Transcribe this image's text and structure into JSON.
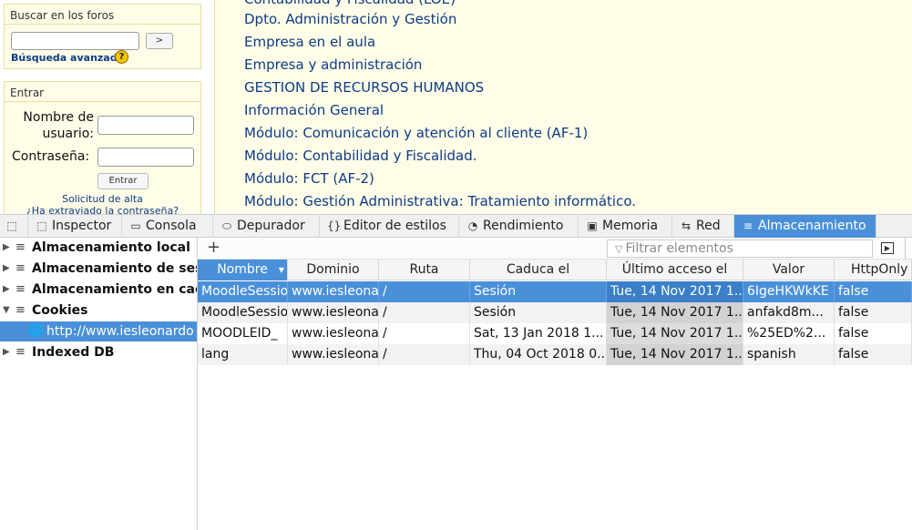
{
  "page": {
    "search_block": {
      "title": "Buscar en los foros",
      "search_button": ">",
      "advanced_link": "Búsqueda avanzada",
      "help_icon": "?"
    },
    "login_block": {
      "title": "Entrar",
      "username_label": "Nombre de usuario:",
      "password_label": "Contraseña:",
      "login_button": "Entrar",
      "signup_link": "Solicitud de alta",
      "forgot_link": "¿Ha extraviado la contraseña?"
    },
    "courses": [
      "Contabilidad y Fiscalidad (LOE)",
      "Dpto. Administración y Gestión",
      "Empresa en el aula",
      "Empresa y administración",
      "GESTION DE RECURSOS HUMANOS",
      "Información General",
      "Módulo: Comunicación y atención al cliente (AF-1)",
      "Módulo: Contabilidad y Fiscalidad.",
      "Módulo: FCT (AF-2)",
      "Módulo: Gestión Administrativa: Tratamiento informático."
    ]
  },
  "devtools": {
    "tools": [
      {
        "label": "Inspector",
        "icon": "inspector-icon",
        "glyph": "⬚"
      },
      {
        "label": "Consola",
        "icon": "console-icon",
        "glyph": "▭"
      },
      {
        "label": "Depurador",
        "icon": "debugger-icon",
        "glyph": "⬭"
      },
      {
        "label": "Editor de estilos",
        "icon": "style-editor-icon",
        "glyph": "{}"
      },
      {
        "label": "Rendimiento",
        "icon": "performance-icon",
        "glyph": "◔"
      },
      {
        "label": "Memoria",
        "icon": "memory-icon",
        "glyph": "▣"
      },
      {
        "label": "Red",
        "icon": "network-icon",
        "glyph": "⇆"
      },
      {
        "label": "Almacenamiento",
        "icon": "storage-icon",
        "glyph": "≡"
      }
    ],
    "active_tool": "Almacenamiento",
    "tree": [
      {
        "label": "Almacenamiento local",
        "expanded": false
      },
      {
        "label": "Almacenamiento de sesión",
        "expanded": false
      },
      {
        "label": "Almacenamiento en caché",
        "expanded": false
      },
      {
        "label": "Cookies",
        "expanded": true
      },
      {
        "label": "http://www.iesleonardo",
        "selected": true
      },
      {
        "label": "Indexed DB",
        "expanded": false
      }
    ],
    "filter_placeholder": "Filtrar elementos",
    "add_glyph": "+",
    "columns": [
      "Nombre",
      "Dominio",
      "Ruta",
      "Caduca el",
      "Último acceso el",
      "Valor",
      "HttpOnly"
    ],
    "sorted_column": "Nombre",
    "rows": [
      [
        "MoodleSession",
        "www.iesleonardo.info",
        "/",
        "Sesión",
        "Tue, 14 Nov 2017 1...",
        "6IgeHKWkKE",
        "false"
      ],
      [
        "MoodleSessionTest",
        "www.iesleonardo.info",
        "/",
        "Sesión",
        "Tue, 14 Nov 2017 1...",
        "anfakd8m...",
        "false"
      ],
      [
        "MOODLEID_",
        "www.iesleonardo.info",
        "/",
        "Sat, 13 Jan 2018 1...",
        "Tue, 14 Nov 2017 1...",
        "%25ED%2...",
        "false"
      ],
      [
        "lang",
        "www.iesleonardo.info",
        "/",
        "Thu, 04 Oct 2018 0...",
        "Tue, 14 Nov 2017 1...",
        "spanish",
        "false"
      ]
    ],
    "selected_row": 0,
    "accent_color": "#4a90d9"
  }
}
